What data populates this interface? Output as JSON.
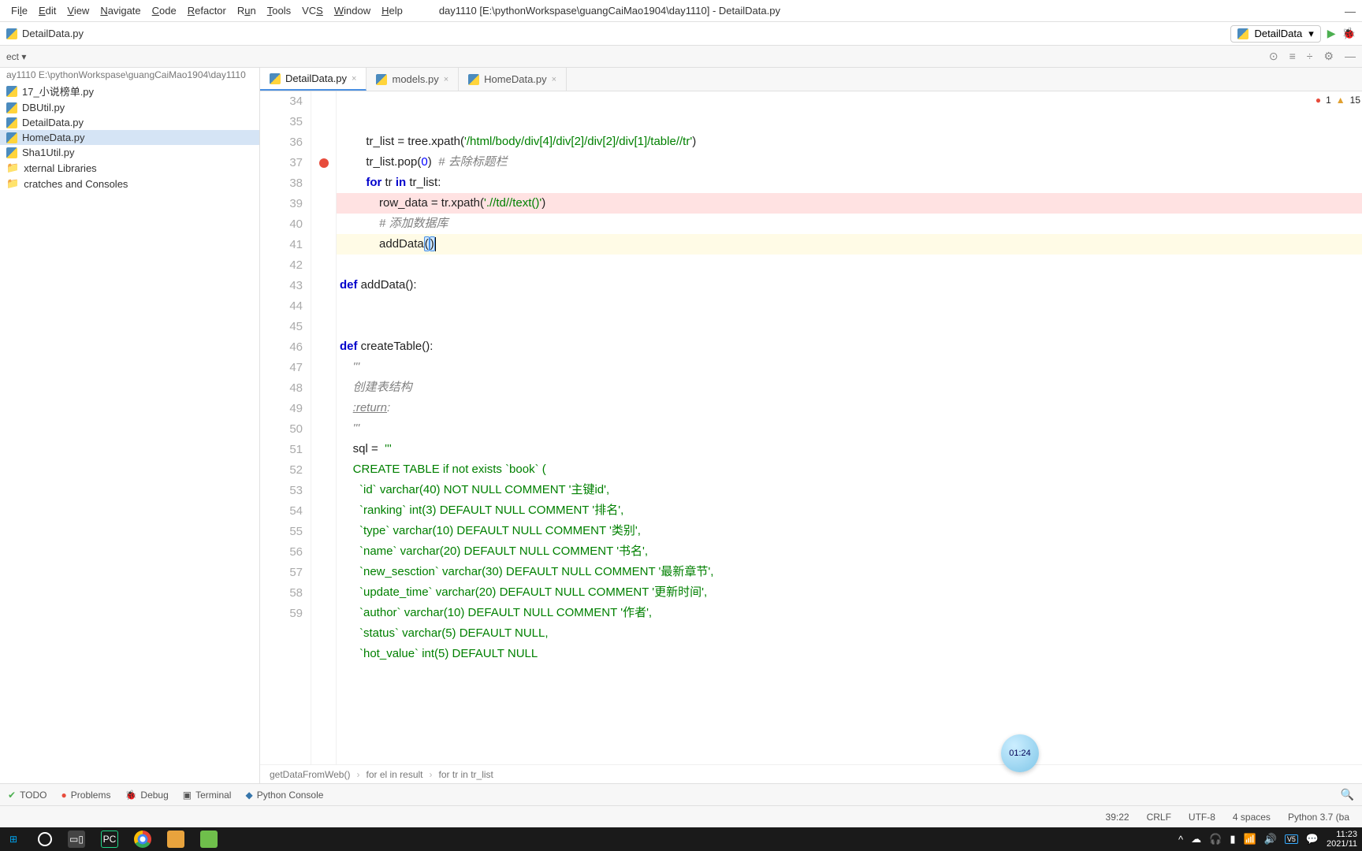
{
  "menu": {
    "file": "File",
    "edit": "Edit",
    "view": "View",
    "navigate": "Navigate",
    "code": "Code",
    "refactor": "Refactor",
    "run": "Run",
    "tools": "Tools",
    "vcs": "VCS",
    "window": "Window",
    "help": "Help"
  },
  "window_title": "day1110 [E:\\pythonWorkspase\\guangCaiMao1904\\day1110] - DetailData.py",
  "open_file": "DetailData.py",
  "run_config": "DetailData",
  "nav_path": "ay1110  E:\\pythonWorkspase\\guangCaiMao1904\\day1110",
  "tree": [
    {
      "label": "17_小说榜单.py"
    },
    {
      "label": "DBUtil.py"
    },
    {
      "label": "DetailData.py",
      "selected": false
    },
    {
      "label": "HomeData.py",
      "selected": true
    },
    {
      "label": "Sha1Util.py"
    },
    {
      "label": "xternal Libraries",
      "folder": true
    },
    {
      "label": "cratches and Consoles",
      "folder": true
    }
  ],
  "tabs": [
    {
      "label": "DetailData.py",
      "active": true
    },
    {
      "label": "models.py"
    },
    {
      "label": "HomeData.py"
    }
  ],
  "errors": {
    "err": "1",
    "warn": "15"
  },
  "code_lines": [
    {
      "n": 34,
      "html": "        tr_list = tree.xpath(<span class='str'>'/html/body/div[4]/div[2]/div[2]/div[1]/table//tr'</span>)"
    },
    {
      "n": 35,
      "html": "        tr_list.pop(<span class='num'>0</span>)  <span class='cmt'># 去除标题栏</span>"
    },
    {
      "n": 36,
      "html": "        <span class='kw'>for</span> tr <span class='kw'>in</span> tr_list:"
    },
    {
      "n": 37,
      "html": "            row_data = tr.xpath(<span class='str'>'.//td//text()'</span>)",
      "bp": true
    },
    {
      "n": 38,
      "html": "            <span class='cmt'># 添加数据库</span>"
    },
    {
      "n": 39,
      "html": "            addData<span class='paren-hl'>(</span><span class='paren-hl'>)</span><span class='cursor-blink'></span>",
      "caret": true
    },
    {
      "n": 40,
      "html": ""
    },
    {
      "n": 41,
      "html": "<span class='kw'>def</span> <span class='fn'>addData</span>():"
    },
    {
      "n": 42,
      "html": ""
    },
    {
      "n": 43,
      "html": ""
    },
    {
      "n": 44,
      "html": "<span class='kw'>def</span> <span class='fn'>createTable</span>():"
    },
    {
      "n": 45,
      "html": "    <span class='tdq'>'''</span>"
    },
    {
      "n": 46,
      "html": "    <span class='tdq'>创建表结构</span>"
    },
    {
      "n": 47,
      "html": "    <span class='tdq'><u>:return</u>:</span>"
    },
    {
      "n": 48,
      "html": "    <span class='tdq'>'''</span>"
    },
    {
      "n": 49,
      "html": "    sql =  <span class='str'>'''</span>"
    },
    {
      "n": 50,
      "html": "<span class='str'>    CREATE TABLE if not exists `book` (</span>"
    },
    {
      "n": 51,
      "html": "<span class='str'>      `id` varchar(40) NOT NULL COMMENT '主键id',</span>"
    },
    {
      "n": 52,
      "html": "<span class='str'>      `ranking` int(3) DEFAULT NULL COMMENT '排名',</span>"
    },
    {
      "n": 53,
      "html": "<span class='str'>      `type` varchar(10) DEFAULT NULL COMMENT '类别',</span>"
    },
    {
      "n": 54,
      "html": "<span class='str'>      `name` varchar(20) DEFAULT NULL COMMENT '书名',</span>"
    },
    {
      "n": 55,
      "html": "<span class='str'>      `new_sesction` varchar(30) DEFAULT NULL COMMENT '最新章节',</span>"
    },
    {
      "n": 56,
      "html": "<span class='str'>      `update_time` varchar(20) DEFAULT NULL COMMENT '更新时间',</span>"
    },
    {
      "n": 57,
      "html": "<span class='str'>      `author` varchar(10) DEFAULT NULL COMMENT '作者',</span>"
    },
    {
      "n": 58,
      "html": "<span class='str'>      `status` varchar(5) DEFAULT NULL,</span>"
    },
    {
      "n": 59,
      "html": "<span class='str'>      `hot_value` int(5) DEFAULT NULL</span>"
    }
  ],
  "breadcrumb": [
    "getDataFromWeb()",
    "for el in result",
    "for tr in tr_list"
  ],
  "tools": {
    "todo": "TODO",
    "problems": "Problems",
    "debug": "Debug",
    "terminal": "Terminal",
    "pycon": "Python Console"
  },
  "status": {
    "pos": "39:22",
    "ending": "CRLF",
    "enc": "UTF-8",
    "indent": "4 spaces",
    "interp": "Python 3.7 (ba"
  },
  "timer": "01:24",
  "clock": {
    "time": "11:23",
    "date": "2021/11"
  }
}
